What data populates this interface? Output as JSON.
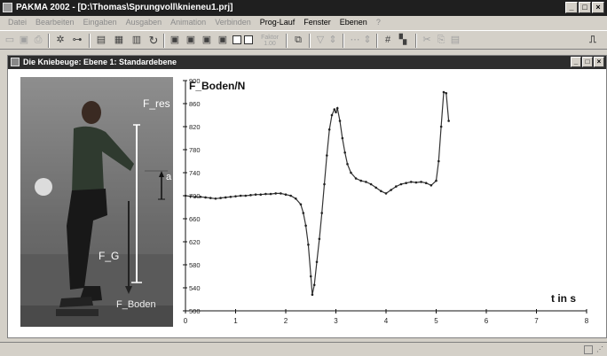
{
  "window": {
    "title": "PAKMA 2002 - [D:\\Thomas\\Sprungvoll\\knieneu1.prj]",
    "min_glyph": "_",
    "max_glyph": "□",
    "close_glyph": "×"
  },
  "menu": [
    {
      "label": "Datei",
      "enabled": false
    },
    {
      "label": "Bearbeiten",
      "enabled": false
    },
    {
      "label": "Eingaben",
      "enabled": false
    },
    {
      "label": "Ausgaben",
      "enabled": false
    },
    {
      "label": "Animation",
      "enabled": false
    },
    {
      "label": "Verbinden",
      "enabled": false
    },
    {
      "label": "Prog-Lauf",
      "enabled": true
    },
    {
      "label": "Fenster",
      "enabled": true
    },
    {
      "label": "Ebenen",
      "enabled": true
    },
    {
      "label": "?",
      "enabled": false
    }
  ],
  "toolbar": {
    "factor_label": "Faktor",
    "factor_value": "1.00"
  },
  "subwindow": {
    "title": "Die Kniebeuge: Ebene 1: Standardebene"
  },
  "photo_labels": {
    "f_res": "F_res",
    "a": "a",
    "f_g": "F_G",
    "f_boden": "F_Boden"
  },
  "chart_data": {
    "type": "line",
    "ylabel": "F_Boden/N",
    "xlabel": "t in s",
    "xlim": [
      0,
      8
    ],
    "ylim": [
      500,
      900
    ],
    "xticks": [
      0,
      1,
      2,
      3,
      4,
      5,
      6,
      7,
      8
    ],
    "yticks": [
      500,
      540,
      580,
      620,
      660,
      700,
      740,
      780,
      820,
      860,
      900
    ],
    "grid": false,
    "series": [
      {
        "markers": true,
        "points": [
          [
            0.0,
            700
          ],
          [
            0.1,
            699
          ],
          [
            0.2,
            698
          ],
          [
            0.3,
            698
          ],
          [
            0.4,
            697
          ],
          [
            0.5,
            696
          ],
          [
            0.6,
            695
          ],
          [
            0.7,
            696
          ],
          [
            0.8,
            697
          ],
          [
            0.9,
            698
          ],
          [
            1.0,
            699
          ],
          [
            1.1,
            700
          ],
          [
            1.2,
            700
          ],
          [
            1.3,
            701
          ],
          [
            1.4,
            702
          ],
          [
            1.5,
            702
          ],
          [
            1.6,
            703
          ],
          [
            1.7,
            703
          ],
          [
            1.8,
            704
          ],
          [
            1.9,
            704
          ],
          [
            2.0,
            702
          ],
          [
            2.1,
            700
          ],
          [
            2.2,
            695
          ],
          [
            2.3,
            685
          ],
          [
            2.35,
            670
          ],
          [
            2.4,
            648
          ],
          [
            2.45,
            615
          ],
          [
            2.5,
            560
          ],
          [
            2.53,
            528
          ],
          [
            2.57,
            545
          ],
          [
            2.62,
            585
          ],
          [
            2.67,
            625
          ],
          [
            2.72,
            670
          ],
          [
            2.77,
            720
          ],
          [
            2.82,
            770
          ],
          [
            2.87,
            815
          ],
          [
            2.92,
            840
          ],
          [
            2.97,
            850
          ],
          [
            3.0,
            845
          ],
          [
            3.03,
            852
          ],
          [
            3.08,
            830
          ],
          [
            3.13,
            800
          ],
          [
            3.18,
            775
          ],
          [
            3.23,
            755
          ],
          [
            3.3,
            740
          ],
          [
            3.4,
            730
          ],
          [
            3.5,
            726
          ],
          [
            3.6,
            724
          ],
          [
            3.7,
            720
          ],
          [
            3.8,
            714
          ],
          [
            3.9,
            708
          ],
          [
            4.0,
            704
          ],
          [
            4.1,
            710
          ],
          [
            4.2,
            716
          ],
          [
            4.3,
            720
          ],
          [
            4.4,
            722
          ],
          [
            4.5,
            724
          ],
          [
            4.6,
            723
          ],
          [
            4.7,
            724
          ],
          [
            4.8,
            722
          ],
          [
            4.9,
            718
          ],
          [
            5.0,
            726
          ],
          [
            5.05,
            760
          ],
          [
            5.1,
            820
          ],
          [
            5.15,
            880
          ],
          [
            5.2,
            878
          ],
          [
            5.25,
            830
          ]
        ]
      }
    ]
  }
}
